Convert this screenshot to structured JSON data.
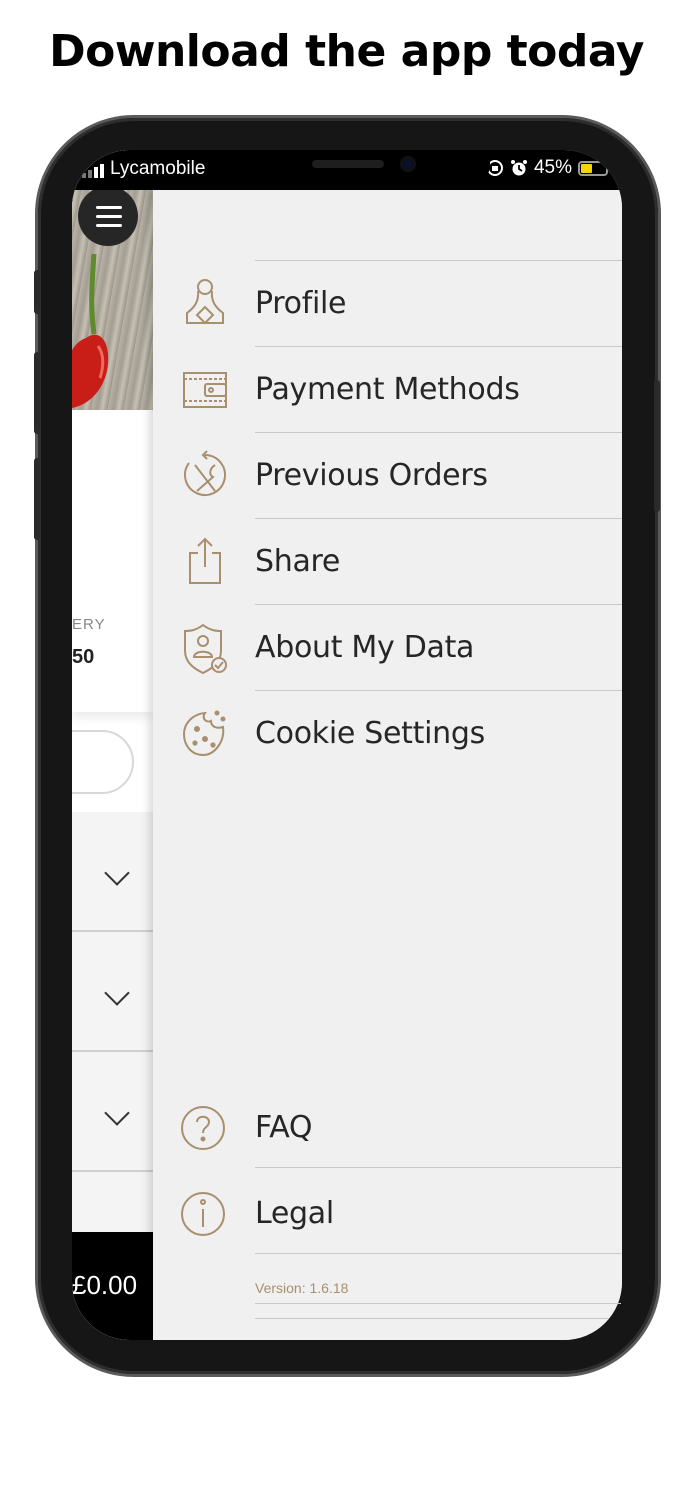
{
  "headline": "Download the app today",
  "status_bar": {
    "carrier": "Lycamobile",
    "battery": "45%",
    "battery_level": 0.45,
    "icons": [
      "signal-icon",
      "lock-rotation-icon",
      "alarm-icon",
      "battery-icon"
    ]
  },
  "background_app": {
    "menu_icon": "hamburger-menu-icon",
    "delivery_label_fragment": "ERY",
    "delivery_value_fragment": "50",
    "total_fragment": "£0.00"
  },
  "drawer": {
    "items": [
      {
        "label": "Profile",
        "icon": "profile-icon"
      },
      {
        "label": "Payment Methods",
        "icon": "wallet-icon"
      },
      {
        "label": "Previous Orders",
        "icon": "previous-orders-icon"
      },
      {
        "label": "Share",
        "icon": "share-icon"
      },
      {
        "label": "About My Data",
        "icon": "data-shield-icon"
      },
      {
        "label": "Cookie Settings",
        "icon": "cookie-icon"
      }
    ],
    "bottom_items": [
      {
        "label": "FAQ",
        "icon": "question-icon"
      },
      {
        "label": "Legal",
        "icon": "info-icon"
      }
    ],
    "version": "Version: 1.6.18"
  },
  "colors": {
    "accent": "#a88f6e",
    "drawer_bg": "#f0f0f0",
    "text": "#262626"
  }
}
